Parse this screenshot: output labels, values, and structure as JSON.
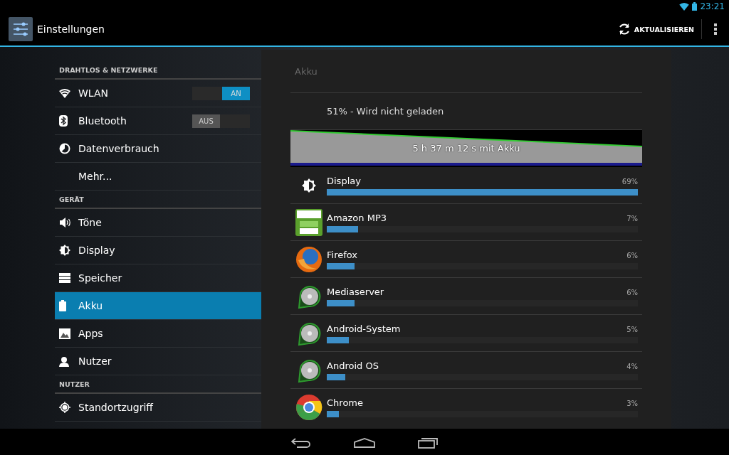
{
  "status_bar": {
    "time": "23:21"
  },
  "action_bar": {
    "title": "Einstellungen",
    "action": "AKTUALISIEREN"
  },
  "sidebar": {
    "sections": [
      {
        "header": "DRAHTLOS & NETZWERKE",
        "items": [
          {
            "label": "WLAN",
            "kind": "toggle",
            "on": true,
            "toggle_label": "AN",
            "selected": false
          },
          {
            "label": "Bluetooth",
            "kind": "toggle",
            "on": false,
            "toggle_label": "AUS",
            "selected": false
          },
          {
            "label": "Datenverbrauch",
            "kind": "plain",
            "selected": false
          },
          {
            "label": "Mehr...",
            "kind": "plain",
            "selected": false
          }
        ]
      },
      {
        "header": "GERÄT",
        "items": [
          {
            "label": "Töne",
            "kind": "plain",
            "selected": false
          },
          {
            "label": "Display",
            "kind": "plain",
            "selected": false
          },
          {
            "label": "Speicher",
            "kind": "plain",
            "selected": false
          },
          {
            "label": "Akku",
            "kind": "plain",
            "selected": true
          },
          {
            "label": "Apps",
            "kind": "plain",
            "selected": false
          },
          {
            "label": "Nutzer",
            "kind": "plain",
            "selected": false
          }
        ]
      },
      {
        "header": "NUTZER",
        "items": [
          {
            "label": "Standortzugriff",
            "kind": "plain",
            "selected": false
          }
        ]
      }
    ]
  },
  "battery": {
    "title": "Akku",
    "status": "51% - Wird nicht geladen",
    "graph_label": "5 h 37 m 12 s mit Akku",
    "apps": [
      {
        "name": "Display",
        "percent": "69%",
        "level": 1.0
      },
      {
        "name": "Amazon MP3",
        "percent": "7%",
        "level": 0.1
      },
      {
        "name": "Firefox",
        "percent": "6%",
        "level": 0.09
      },
      {
        "name": "Mediaserver",
        "percent": "6%",
        "level": 0.09
      },
      {
        "name": "Android-System",
        "percent": "5%",
        "level": 0.07
      },
      {
        "name": "Android OS",
        "percent": "4%",
        "level": 0.06
      },
      {
        "name": "Chrome",
        "percent": "3%",
        "level": 0.04
      }
    ]
  }
}
